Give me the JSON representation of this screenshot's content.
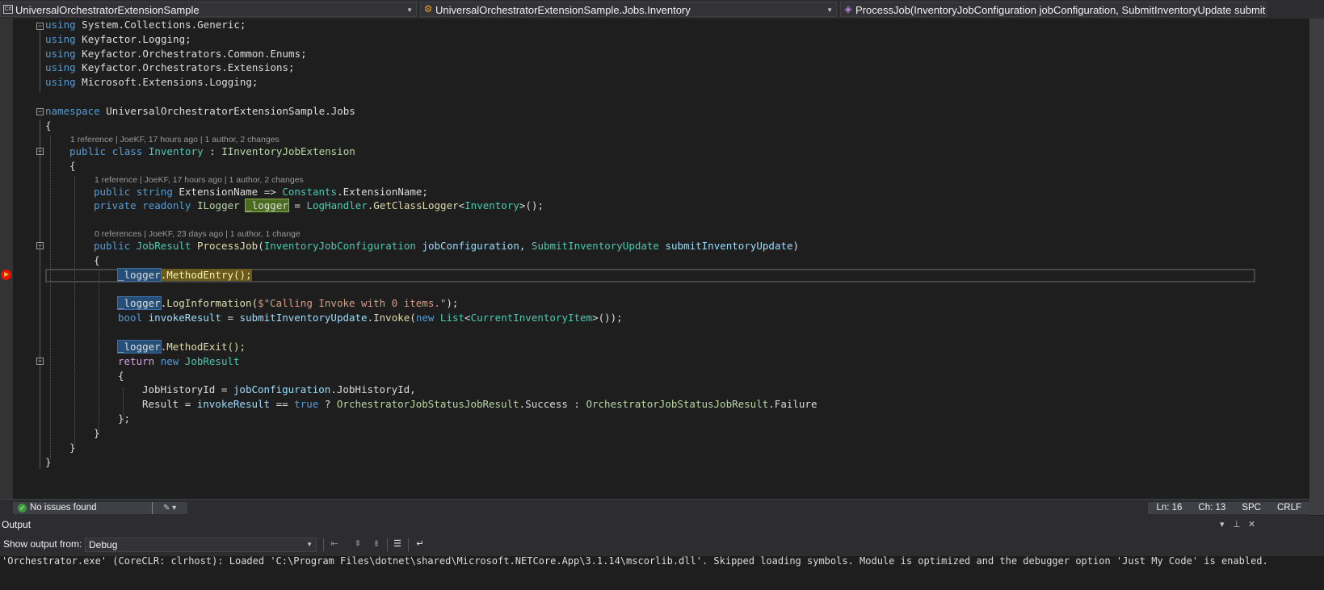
{
  "nav": {
    "project": "UniversalOrchestratorExtensionSample",
    "type": "UniversalOrchestratorExtensionSample.Jobs.Inventory",
    "member": "ProcessJob(InventoryJobConfiguration jobConfiguration, SubmitInventoryUpdate submitInvento"
  },
  "code": {
    "kw_using": "using",
    "using1": "System.Collections.Generic;",
    "using2": "Keyfactor.Logging;",
    "using3": "Keyfactor.Orchestrators.Common.Enums;",
    "using4": "Keyfactor.Orchestrators.Extensions;",
    "using5": "Microsoft.Extensions.Logging;",
    "kw_namespace": "namespace",
    "namespace_name": "UniversalOrchestratorExtensionSample.Jobs",
    "open_brace": "{",
    "close_brace": "}",
    "lens_class": "1 reference | JoeKF, 17 hours ago | 1 author, 2 changes",
    "kw_public": "public",
    "kw_class": "class",
    "class_name": "Inventory",
    "colon": ":",
    "interface_name": "IInventoryJobExtension",
    "lens_ext": "1 reference | JoeKF, 17 hours ago | 1 author, 2 changes",
    "kw_string": "string",
    "prop_name": "ExtensionName",
    "arrow": "=>",
    "constants": "Constants",
    "ext_tail": ".ExtensionName;",
    "kw_private": "private",
    "kw_readonly": "readonly",
    "ilogger": "ILogger",
    "logger": "_logger",
    "equals": "=",
    "loghandler": "LogHandler",
    "dot": ".",
    "get_class_logger": "GetClassLogger",
    "lt": "<",
    "gt_close": ">();",
    "lens_method": "0 references | JoeKF, 23 days ago | 1 author, 1 change",
    "job_result": "JobResult",
    "process_job": "ProcessJob",
    "paren_open": "(",
    "inv_config": "InventoryJobConfiguration",
    "job_configuration": "jobConfiguration",
    "comma": ",",
    "submit_update_type": "SubmitInventoryUpdate",
    "submit_inventory_update": "submitInventoryUpdate",
    "paren_close": ")",
    "method_entry": ".MethodEntry();",
    "log_information": "LogInformation",
    "string_literal": "$\"Calling Invoke with 0 items.\"",
    "close_stmt": ");",
    "kw_bool": "bool",
    "invoke_result": "invokeResult",
    "invoke": "Invoke",
    "kw_new": "new",
    "list_type": "List",
    "current_inventory_item": "CurrentInventoryItem",
    "list_close": ">());",
    "method_exit": ".MethodExit();",
    "kw_return": "return",
    "job_history_id": "JobHistoryId",
    "job_history_tail": ".JobHistoryId,",
    "result_prop": "Result",
    "eq_eq": "==",
    "kw_true": "true",
    "question": "?",
    "status_type": "OrchestratorJobStatusJobResult",
    "success_tail": ".Success",
    "failure_tail": ".Failure",
    "close_semicolon": "};"
  },
  "status": {
    "issues": "No issues found",
    "ln": "Ln: 16",
    "ch": "Ch: 13",
    "spc": "SPC",
    "crlf": "CRLF"
  },
  "output": {
    "title": "Output",
    "show_from_label": "Show output from:",
    "source": "Debug",
    "line1": "'Orchestrator.exe' (CoreCLR: clrhost): Loaded 'C:\\Program Files\\dotnet\\shared\\Microsoft.NETCore.App\\3.1.14\\mscorlib.dll'. Skipped loading symbols. Module is optimized and the debugger option 'Just My Code' is enabled."
  }
}
